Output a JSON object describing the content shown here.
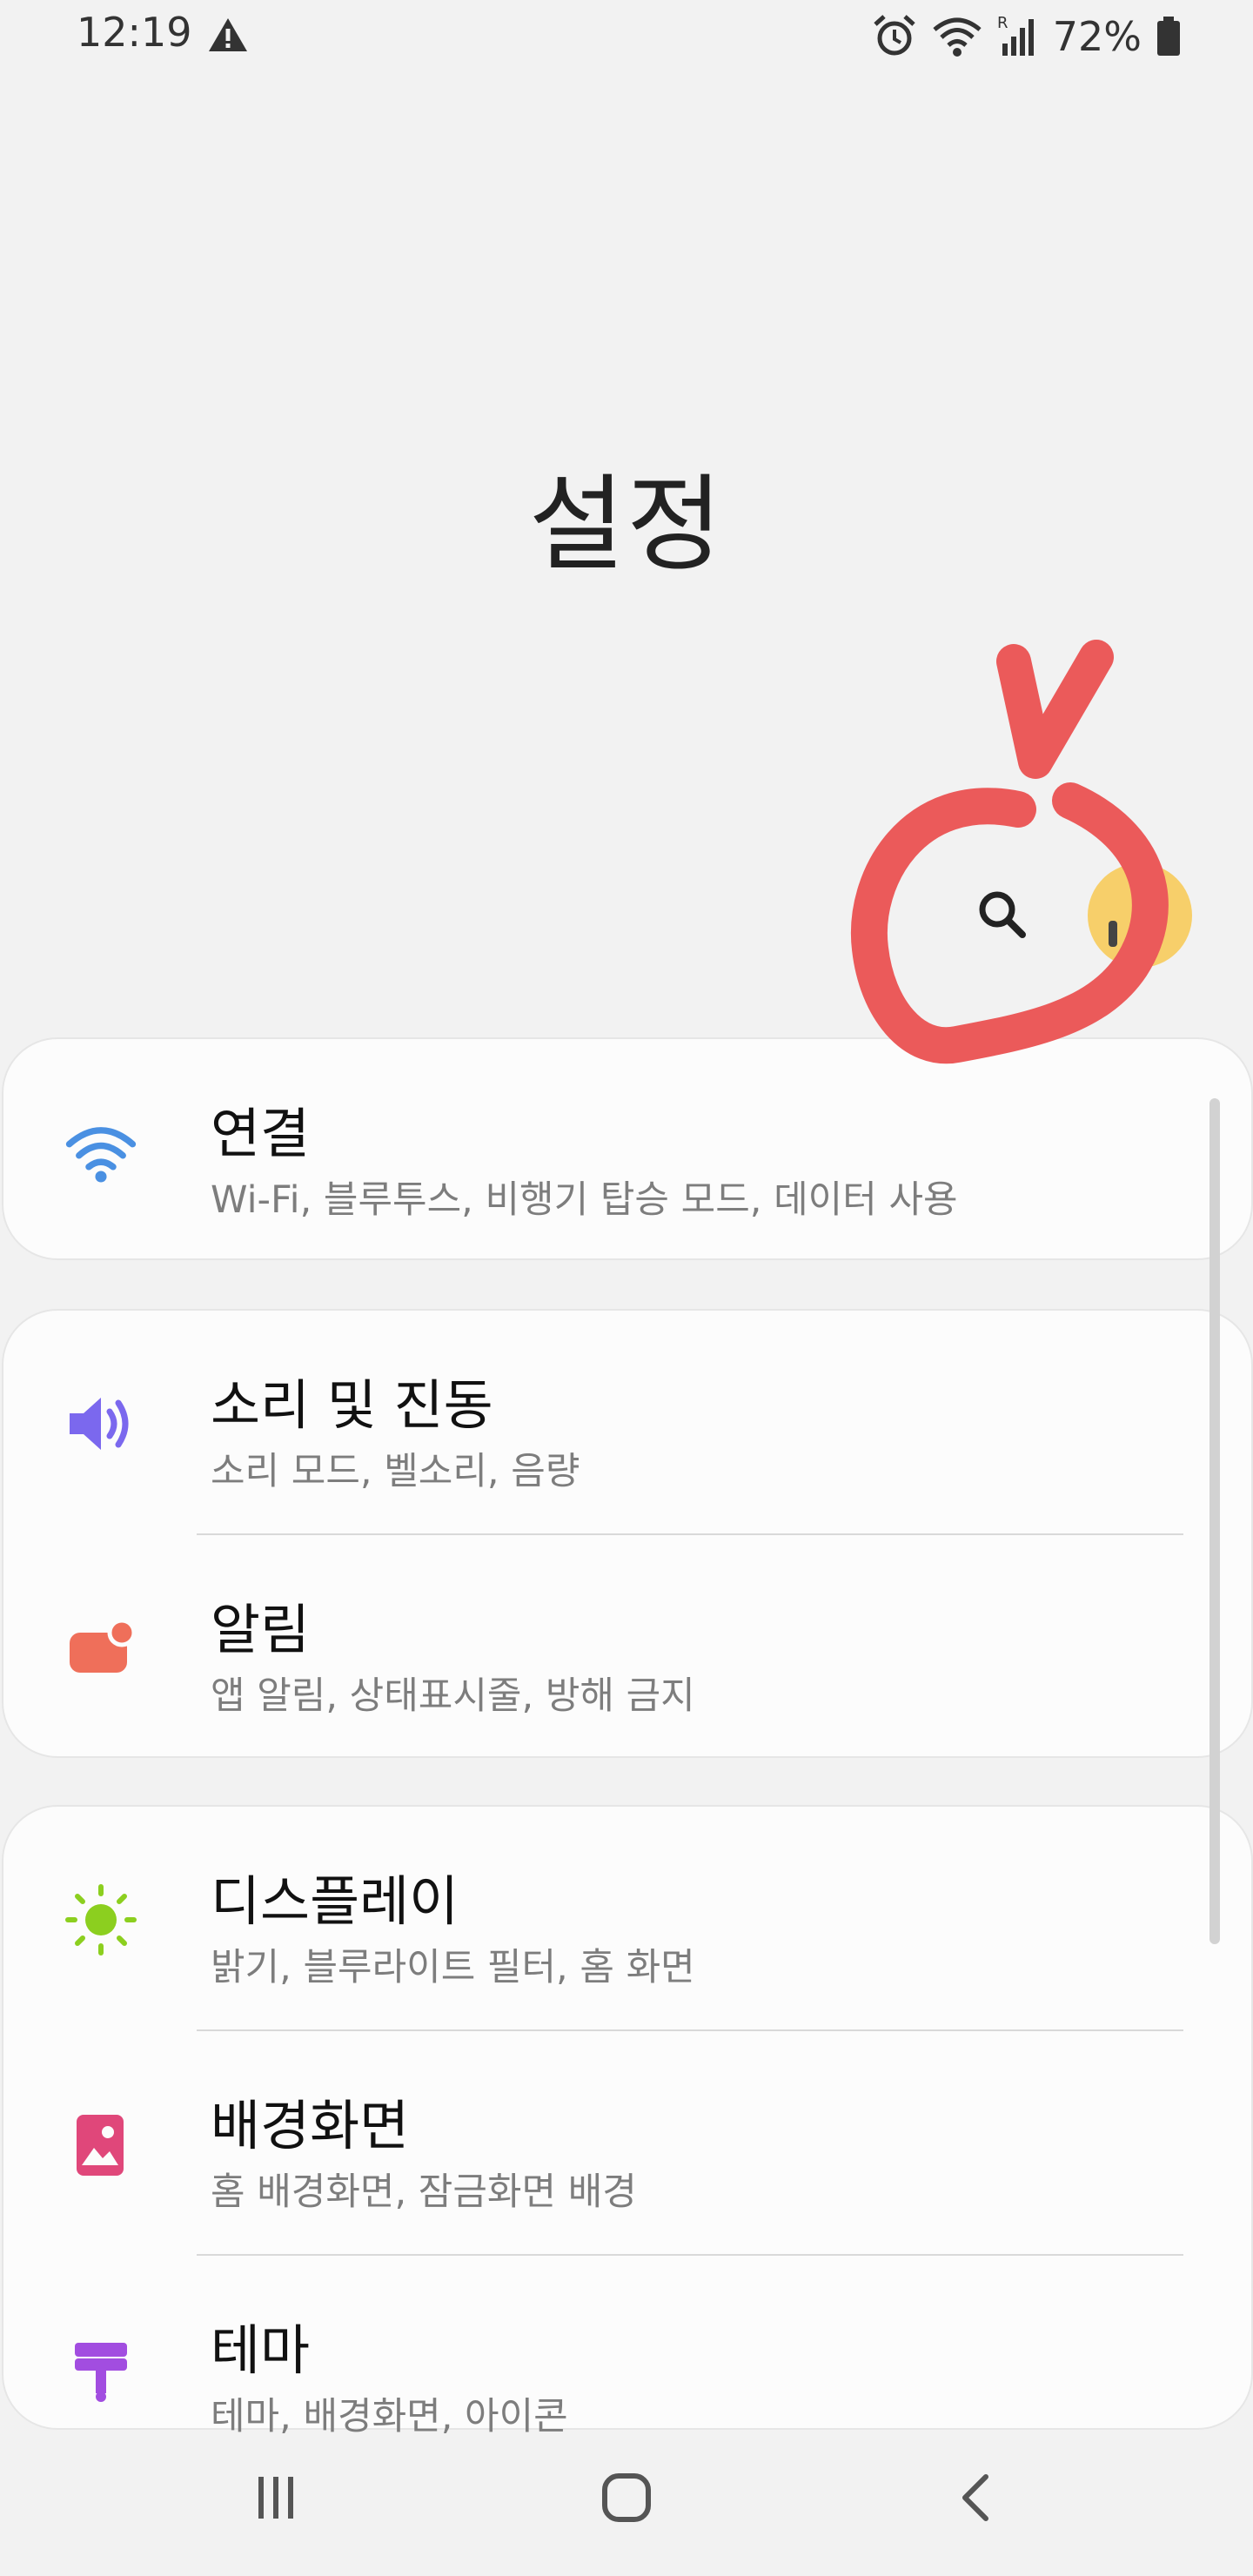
{
  "status_bar": {
    "time": "12:19",
    "battery": "72%",
    "icons": [
      "warning-icon",
      "alarm-icon",
      "wifi-icon",
      "signal-icon",
      "battery-icon"
    ]
  },
  "title": "설정",
  "header": {
    "search_icon": "search-icon",
    "avatar_icon": "profile-avatar"
  },
  "sections": [
    {
      "items": [
        {
          "title": "연결",
          "subtitle": "Wi-Fi, 블루투스, 비행기 탑승 모드, 데이터 사용",
          "icon": "wifi-icon",
          "color": "#4a90e2"
        }
      ]
    },
    {
      "items": [
        {
          "title": "소리 및 진동",
          "subtitle": "소리 모드, 벨소리, 음량",
          "icon": "volume-icon",
          "color": "#7b68ee"
        },
        {
          "title": "알림",
          "subtitle": "앱 알림, 상태표시줄, 방해 금지",
          "icon": "notification-icon",
          "color": "#ef6f5a"
        }
      ]
    },
    {
      "items": [
        {
          "title": "디스플레이",
          "subtitle": "밝기, 블루라이트 필터, 홈 화면",
          "icon": "brightness-icon",
          "color": "#8ccf1f"
        },
        {
          "title": "배경화면",
          "subtitle": "홈 배경화면, 잠금화면 배경",
          "icon": "wallpaper-icon",
          "color": "#e0477a"
        },
        {
          "title": "테마",
          "subtitle": "테마, 배경화면, 아이콘",
          "icon": "theme-icon",
          "color": "#a24de0"
        }
      ]
    }
  ],
  "nav": [
    "recent-apps-icon",
    "home-icon",
    "back-icon"
  ],
  "annotation_color": "#eb5a5a"
}
